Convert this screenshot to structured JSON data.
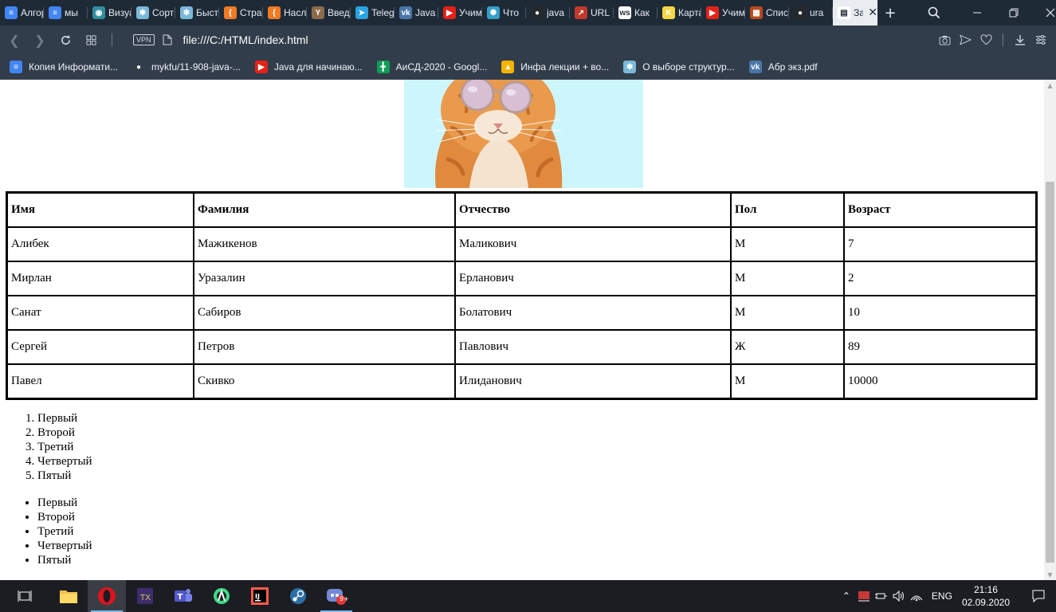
{
  "browser": {
    "tabs": [
      {
        "label": "Алгоритмы",
        "icon": "google-docs-icon",
        "color": "#4285f4",
        "glyph": "≡"
      },
      {
        "label": "мы",
        "icon": "google-docs-icon",
        "color": "#4285f4",
        "glyph": "≡"
      },
      {
        "label": "Визуализация",
        "icon": "visualgo-icon",
        "color": "#2f8f9d",
        "glyph": "◉"
      },
      {
        "label": "Сортировка",
        "icon": "gear-site-icon",
        "color": "#7ab8d8",
        "glyph": "✱"
      },
      {
        "label": "Быстрая",
        "icon": "gear-site-icon",
        "color": "#7ab8d8",
        "glyph": "✱"
      },
      {
        "label": "Страница",
        "icon": "shield-orange-icon",
        "color": "#f07b24",
        "glyph": "{"
      },
      {
        "label": "Наследование",
        "icon": "shield-orange-icon",
        "color": "#f07b24",
        "glyph": "{"
      },
      {
        "label": "Введение",
        "icon": "tree-icon",
        "color": "#8b6b4a",
        "glyph": "Y"
      },
      {
        "label": "Telegram",
        "icon": "telegram-icon",
        "color": "#2aa3e0",
        "glyph": "➤"
      },
      {
        "label": "Java",
        "icon": "vk-icon",
        "color": "#4a76a8",
        "glyph": "vk"
      },
      {
        "label": "Учим",
        "icon": "youtube-icon",
        "color": "#e62117",
        "glyph": "▶"
      },
      {
        "label": "Что",
        "icon": "pattern-icon",
        "color": "#35a0c9",
        "glyph": "✺"
      },
      {
        "label": "java",
        "icon": "github-icon",
        "color": "#24292e",
        "glyph": "●"
      },
      {
        "label": "URL",
        "icon": "url-icon",
        "color": "#c0392b",
        "glyph": "↗"
      },
      {
        "label": "Как",
        "icon": "ws-icon",
        "color": "#ffffff",
        "glyph": "ws"
      },
      {
        "label": "Карта",
        "icon": "k-icon",
        "color": "#f5d742",
        "glyph": "K"
      },
      {
        "label": "Учим",
        "icon": "youtube-icon",
        "color": "#e62117",
        "glyph": "▶"
      },
      {
        "label": "Список",
        "icon": "blocks-icon",
        "color": "#b84a1d",
        "glyph": "▦"
      },
      {
        "label": "ura",
        "icon": "github-icon",
        "color": "#24292e",
        "glyph": "●"
      },
      {
        "label": "Задание",
        "icon": "file-icon",
        "color": "#ffffff",
        "glyph": "▤",
        "active": true
      }
    ],
    "url": "file:///C:/HTML/index.html",
    "vpn_label": "VPN",
    "bookmarks": [
      {
        "label": "Копия Информати...",
        "icon": "google-docs-icon",
        "color": "#4285f4",
        "glyph": "≡"
      },
      {
        "label": "mykfu/11-908-java-...",
        "icon": "github-icon",
        "color": "#ffffff",
        "glyph": "●"
      },
      {
        "label": "Java для начинаю...",
        "icon": "youtube-icon",
        "color": "#e62117",
        "glyph": "▶"
      },
      {
        "label": "АиСД-2020 - Googl...",
        "icon": "google-sheets-icon",
        "color": "#0f9d58",
        "glyph": "╋"
      },
      {
        "label": "Инфа лекции + во...",
        "icon": "google-drive-icon",
        "color": "#f4b400",
        "glyph": "▲"
      },
      {
        "label": "О выборе структур...",
        "icon": "gear-site-icon",
        "color": "#7ab8d8",
        "glyph": "✱"
      },
      {
        "label": "Абр экз.pdf",
        "icon": "vk-icon",
        "color": "#4a76a8",
        "glyph": "vk"
      }
    ]
  },
  "page": {
    "table": {
      "headers": [
        "Имя",
        "Фамилия",
        "Отчество",
        "Пол",
        "Возраст"
      ],
      "rows": [
        [
          "Алибек",
          "Мажикенов",
          "Маликович",
          "М",
          "7"
        ],
        [
          "Мирлан",
          "Уразалин",
          "Ерланович",
          "М",
          "2"
        ],
        [
          "Санат",
          "Сабиров",
          "Болатович",
          "М",
          "10"
        ],
        [
          "Сергей",
          "Петров",
          "Павлович",
          "Ж",
          "89"
        ],
        [
          "Павел",
          "Скивко",
          "Илиданович",
          "М",
          "10000"
        ]
      ]
    },
    "ordered_list": [
      "Первый",
      "Второй",
      "Третий",
      "Четвертый",
      "Пятый"
    ],
    "unordered_list": [
      "Первый",
      "Второй",
      "Третий",
      "Четвертый",
      "Пятый"
    ]
  },
  "taskbar": {
    "language": "ENG",
    "time": "21:16",
    "date": "02.09.2020",
    "notification_badge": "9+"
  },
  "colors": {
    "tabbar_bg": "#1f2a37",
    "toolbar_bg": "#323d4b",
    "image_bg": "#cdf6fc",
    "taskbar_bg": "#1b1d22",
    "opera_red": "#e0131e"
  }
}
